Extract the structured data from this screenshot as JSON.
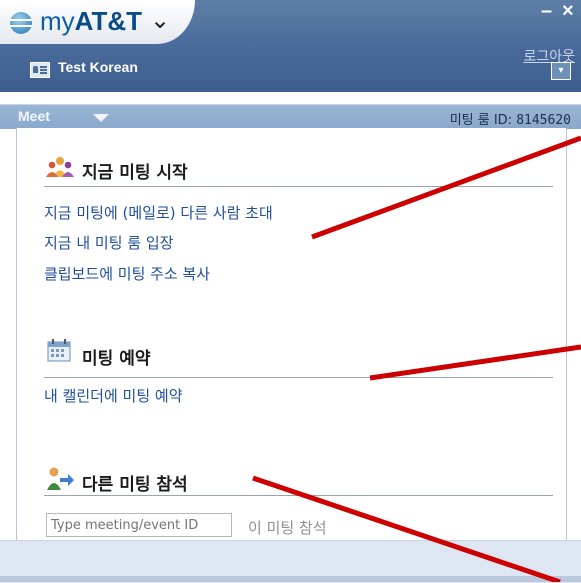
{
  "header": {
    "brand_prefix": "my",
    "brand_name": "AT&T",
    "brand_caret": "⌄",
    "minimize": "–",
    "close": "×",
    "logout": "로그아웃",
    "user_name": "Test Korean",
    "menu_glyph": "▾"
  },
  "meet_bar": {
    "label": "Meet",
    "room_id_label": "미팅 룸 ID:",
    "room_id": "8145620"
  },
  "sections": {
    "start": {
      "title": "지금 미팅 시작",
      "links": [
        "지금 미팅에 (메일로) 다른 사람 초대",
        "지금 내 미팅 룸 입장",
        "클립보드에 미팅 주소 복사"
      ]
    },
    "schedule": {
      "title": "미팅 예약",
      "links": [
        "내 캘린더에 미팅 예약"
      ]
    },
    "join": {
      "title": "다른 미팅 참석",
      "input_placeholder": "Type meeting/event ID",
      "join_label": "이 미팅 참석"
    }
  },
  "colors": {
    "titlebar": "#48699a",
    "link": "#1f4f9e",
    "annotation_line": "#cc0000"
  },
  "icons": {
    "globe": "att-globe-icon",
    "user": "user-card-icon",
    "meeting": "people-group-icon",
    "calendar": "calendar-icon",
    "join": "person-arrow-icon"
  }
}
